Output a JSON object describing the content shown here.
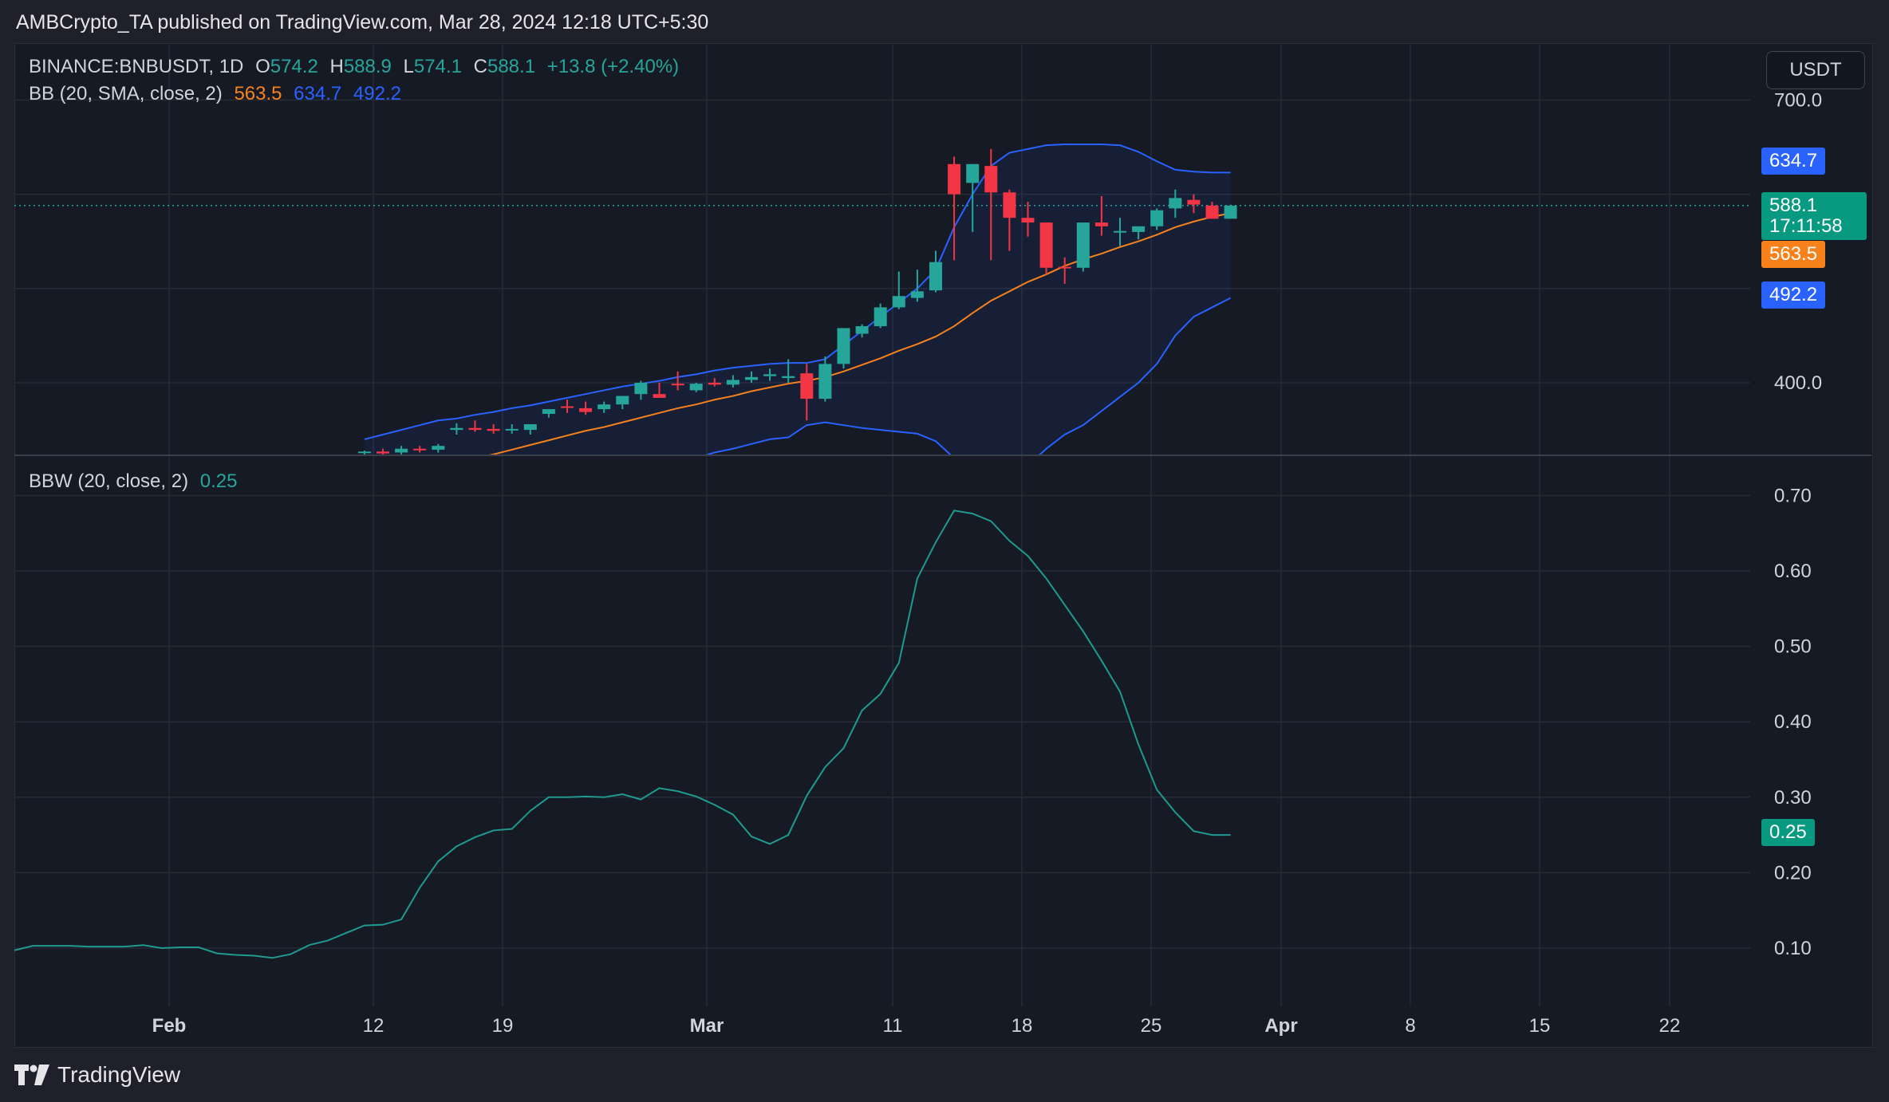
{
  "header": {
    "publisher_line": "AMBCrypto_TA published on TradingView.com, Mar 28, 2024 12:18 UTC+5:30"
  },
  "currency_button": "USDT",
  "legend_main": {
    "symbol": "BINANCE:BNBUSDT, 1D",
    "o_label": "O",
    "o_value": "574.2",
    "h_label": "H",
    "h_value": "588.9",
    "l_label": "L",
    "l_value": "574.1",
    "c_label": "C",
    "c_value": "588.1",
    "change": "+13.8 (+2.40%)"
  },
  "legend_bb": {
    "label": "BB (20, SMA, close, 2)",
    "basis": "563.5",
    "upper": "634.7",
    "lower": "492.2"
  },
  "legend_bbw": {
    "label": "BBW (20, close, 2)",
    "value": "0.25"
  },
  "price_tags": {
    "upper": "634.7",
    "last": "588.1",
    "countdown": "17:11:58",
    "basis": "563.5",
    "lower": "492.2",
    "bbw": "0.25"
  },
  "footer": {
    "brand": "TradingView"
  },
  "colors": {
    "up": "#26a69a",
    "down": "#f23645",
    "basis": "#f7821b",
    "band": "#2962ff",
    "bbw": "#1f9a8f"
  },
  "chart_data": [
    {
      "type": "candlestick",
      "title": "BINANCE:BNBUSDT, 1D",
      "y_tick_labels": [
        "700.0",
        "400.0"
      ],
      "x_tick_labels": [
        "Feb",
        "12",
        "19",
        "Mar",
        "11",
        "18",
        "25",
        "Apr",
        "8",
        "15",
        "22"
      ],
      "ylim": [
        310,
        735
      ],
      "dates": [
        "Feb 10",
        "Feb 11",
        "Feb 12",
        "Feb 13",
        "Feb 14",
        "Feb 15",
        "Feb 16",
        "Feb 17",
        "Feb 18",
        "Feb 19",
        "Feb 20",
        "Feb 21",
        "Feb 22",
        "Feb 23",
        "Feb 24",
        "Feb 25",
        "Feb 26",
        "Feb 27",
        "Feb 28",
        "Feb 29",
        "Mar 1",
        "Mar 2",
        "Mar 3",
        "Mar 4",
        "Mar 5",
        "Mar 6",
        "Mar 7",
        "Mar 8",
        "Mar 9",
        "Mar 10",
        "Mar 11",
        "Mar 12",
        "Mar 13",
        "Mar 14",
        "Mar 15",
        "Mar 16",
        "Mar 17",
        "Mar 18",
        "Mar 19",
        "Mar 20",
        "Mar 21",
        "Mar 22",
        "Mar 23",
        "Mar 24",
        "Mar 25",
        "Mar 26",
        "Mar 27",
        "Mar 28"
      ],
      "open": [
        326,
        327,
        326,
        330,
        329,
        350,
        352,
        351,
        350,
        350,
        367,
        375,
        373,
        372,
        377,
        388,
        388,
        399,
        392,
        400,
        398,
        403,
        407,
        405,
        410,
        383,
        420,
        452,
        460,
        480,
        490,
        498,
        632,
        612,
        630,
        602,
        575,
        570,
        523,
        522,
        570,
        560,
        560,
        566,
        585,
        594,
        588,
        574
      ],
      "high": [
        328,
        330,
        333,
        333,
        335,
        357,
        360,
        356,
        356,
        356,
        370,
        382,
        380,
        380,
        385,
        402,
        400,
        412,
        400,
        405,
        408,
        412,
        415,
        425,
        420,
        428,
        450,
        462,
        484,
        518,
        520,
        540,
        640,
        632,
        648,
        605,
        592,
        570,
        533,
        532,
        598,
        575,
        563,
        585,
        605,
        600,
        592,
        589
      ],
      "low": [
        322,
        323,
        324,
        326,
        326,
        345,
        348,
        346,
        346,
        345,
        363,
        368,
        366,
        368,
        372,
        382,
        385,
        392,
        390,
        396,
        395,
        400,
        402,
        400,
        360,
        380,
        415,
        448,
        458,
        478,
        486,
        496,
        530,
        560,
        530,
        540,
        555,
        515,
        505,
        518,
        556,
        545,
        552,
        562,
        575,
        580,
        575,
        574
      ],
      "close": [
        327,
        325,
        330,
        329,
        333,
        352,
        350,
        349,
        351,
        356,
        372,
        374,
        369,
        377,
        386,
        400,
        384,
        398,
        399,
        398,
        403,
        406,
        409,
        407,
        383,
        420,
        458,
        460,
        480,
        492,
        497,
        528,
        600,
        632,
        602,
        575,
        570,
        522,
        522,
        570,
        566,
        561,
        566,
        583,
        596,
        589,
        574,
        588
      ]
    },
    {
      "type": "line",
      "name": "BB (20, SMA, close, 2)",
      "dates_ref": "same as candlestick",
      "basis": [
        300,
        302,
        305,
        308,
        312,
        316,
        320,
        324,
        329,
        334,
        339,
        344,
        349,
        353,
        358,
        363,
        368,
        373,
        377,
        382,
        386,
        391,
        395,
        399,
        402,
        406,
        412,
        419,
        426,
        434,
        441,
        449,
        460,
        474,
        487,
        497,
        507,
        515,
        524,
        531,
        537,
        544,
        550,
        557,
        565,
        571,
        576,
        580
      ],
      "upper": [
        340,
        345,
        350,
        355,
        360,
        362,
        366,
        369,
        373,
        376,
        380,
        384,
        388,
        392,
        396,
        399,
        402,
        406,
        409,
        413,
        416,
        418,
        420,
        421,
        421,
        425,
        440,
        455,
        470,
        485,
        500,
        520,
        565,
        600,
        630,
        644,
        648,
        652,
        653,
        653,
        653,
        652,
        645,
        635,
        626,
        624,
        623,
        623
      ],
      "lower": [
        262,
        263,
        264,
        265,
        266,
        268,
        270,
        272,
        275,
        278,
        282,
        286,
        290,
        296,
        300,
        304,
        310,
        315,
        320,
        326,
        330,
        335,
        340,
        342,
        355,
        358,
        355,
        352,
        350,
        348,
        346,
        338,
        320,
        300,
        290,
        298,
        312,
        330,
        345,
        355,
        370,
        385,
        400,
        420,
        450,
        470,
        480,
        490
      ]
    },
    {
      "type": "line",
      "name": "BBW (20, close, 2)",
      "y_tick_labels": [
        "0.70",
        "0.60",
        "0.50",
        "0.40",
        "0.30",
        "0.20",
        "0.10"
      ],
      "ylim": [
        0.05,
        0.73
      ],
      "dates": [
        "Jan 22",
        "Jan 23",
        "Jan 24",
        "Jan 25",
        "Jan 26",
        "Jan 27",
        "Jan 28",
        "Jan 29",
        "Jan 30",
        "Jan 31",
        "Feb 1",
        "Feb 2",
        "Feb 3",
        "Feb 4",
        "Feb 5",
        "Feb 6",
        "Feb 7",
        "Feb 8",
        "Feb 9",
        "Feb 10",
        "Feb 11",
        "Feb 12",
        "Feb 13",
        "Feb 14",
        "Feb 15",
        "Feb 16",
        "Feb 17",
        "Feb 18",
        "Feb 19",
        "Feb 20",
        "Feb 21",
        "Feb 22",
        "Feb 23",
        "Feb 24",
        "Feb 25",
        "Feb 26",
        "Feb 27",
        "Feb 28",
        "Feb 29",
        "Mar 1",
        "Mar 2",
        "Mar 3",
        "Mar 4",
        "Mar 5",
        "Mar 6",
        "Mar 7",
        "Mar 8",
        "Mar 9",
        "Mar 10",
        "Mar 11",
        "Mar 12",
        "Mar 13",
        "Mar 14",
        "Mar 15",
        "Mar 16",
        "Mar 17",
        "Mar 18",
        "Mar 19",
        "Mar 20",
        "Mar 21",
        "Mar 22",
        "Mar 23",
        "Mar 24",
        "Mar 25",
        "Mar 26",
        "Mar 27",
        "Mar 28"
      ],
      "values": [
        0.097,
        0.103,
        0.103,
        0.103,
        0.102,
        0.102,
        0.102,
        0.104,
        0.1,
        0.101,
        0.101,
        0.093,
        0.091,
        0.09,
        0.087,
        0.092,
        0.104,
        0.11,
        0.12,
        0.13,
        0.131,
        0.138,
        0.18,
        0.215,
        0.235,
        0.247,
        0.256,
        0.258,
        0.282,
        0.3,
        0.3,
        0.301,
        0.3,
        0.304,
        0.297,
        0.312,
        0.308,
        0.301,
        0.29,
        0.277,
        0.248,
        0.238,
        0.25,
        0.302,
        0.34,
        0.365,
        0.415,
        0.437,
        0.478,
        0.59,
        0.638,
        0.68,
        0.676,
        0.666,
        0.64,
        0.62,
        0.59,
        0.555,
        0.52,
        0.481,
        0.44,
        0.37,
        0.31,
        0.28,
        0.255,
        0.25,
        0.25
      ]
    }
  ]
}
